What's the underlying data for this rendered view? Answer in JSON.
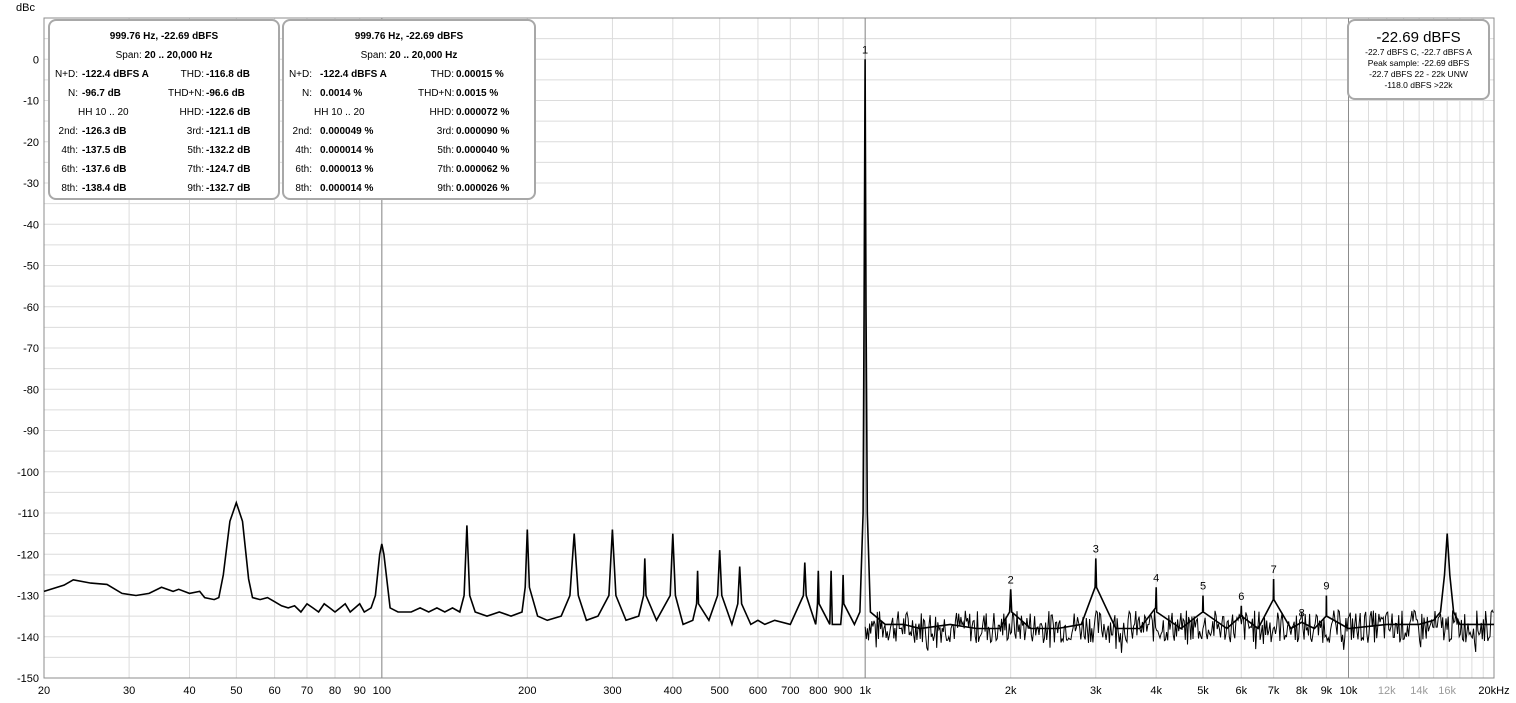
{
  "chart_data": {
    "type": "line",
    "ylabel": "dBc",
    "x_scale": "log",
    "xlim": [
      20,
      20000
    ],
    "ylim": [
      -150,
      10
    ],
    "x_ticks": [
      {
        "v": 20,
        "t": "20"
      },
      {
        "v": 30,
        "t": "30"
      },
      {
        "v": 40,
        "t": "40"
      },
      {
        "v": 50,
        "t": "50"
      },
      {
        "v": 60,
        "t": "60"
      },
      {
        "v": 70,
        "t": "70"
      },
      {
        "v": 80,
        "t": "80"
      },
      {
        "v": 90,
        "t": "90"
      },
      {
        "v": 100,
        "t": "100"
      },
      {
        "v": 200,
        "t": "200"
      },
      {
        "v": 300,
        "t": "300"
      },
      {
        "v": 400,
        "t": "400"
      },
      {
        "v": 500,
        "t": "500"
      },
      {
        "v": 600,
        "t": "600"
      },
      {
        "v": 700,
        "t": "700"
      },
      {
        "v": 800,
        "t": "800"
      },
      {
        "v": 900,
        "t": "900"
      },
      {
        "v": 1000,
        "t": "1k"
      },
      {
        "v": 2000,
        "t": "2k"
      },
      {
        "v": 3000,
        "t": "3k"
      },
      {
        "v": 4000,
        "t": "4k"
      },
      {
        "v": 5000,
        "t": "5k"
      },
      {
        "v": 6000,
        "t": "6k"
      },
      {
        "v": 7000,
        "t": "7k"
      },
      {
        "v": 8000,
        "t": "8k"
      },
      {
        "v": 9000,
        "t": "9k"
      },
      {
        "v": 10000,
        "t": "10k"
      },
      {
        "v": 12000,
        "t": "12k"
      },
      {
        "v": 14000,
        "t": "14k"
      },
      {
        "v": 16000,
        "t": "16k"
      },
      {
        "v": 20000,
        "t": "20kHz"
      }
    ],
    "y_ticks": [
      0,
      -10,
      -20,
      -30,
      -40,
      -50,
      -60,
      -70,
      -80,
      -90,
      -100,
      -110,
      -120,
      -130,
      -140,
      -150
    ],
    "grid": true,
    "series": [
      {
        "points": [
          [
            20,
            -129
          ],
          [
            22,
            -127.5
          ],
          [
            23,
            -126.2
          ],
          [
            25,
            -127
          ],
          [
            27,
            -127.3
          ],
          [
            29,
            -129.5
          ],
          [
            31,
            -130
          ],
          [
            33,
            -129.5
          ],
          [
            35,
            -128
          ],
          [
            37,
            -129
          ],
          [
            38,
            -128.5
          ],
          [
            40,
            -129.5
          ],
          [
            42,
            -129
          ],
          [
            43,
            -130.5
          ],
          [
            45,
            -131
          ],
          [
            46,
            -130.5
          ],
          [
            47,
            -125
          ],
          [
            48.5,
            -112
          ],
          [
            50,
            -107.5
          ],
          [
            51.5,
            -112
          ],
          [
            53,
            -126
          ],
          [
            54,
            -130.5
          ],
          [
            56,
            -131
          ],
          [
            58,
            -130.5
          ],
          [
            60,
            -131.5
          ],
          [
            62,
            -132.5
          ],
          [
            64,
            -133
          ],
          [
            66,
            -132.5
          ],
          [
            68,
            -134
          ],
          [
            70,
            -132
          ],
          [
            72,
            -133
          ],
          [
            74,
            -134
          ],
          [
            76,
            -132
          ],
          [
            78,
            -133
          ],
          [
            80,
            -134
          ],
          [
            82,
            -133
          ],
          [
            84,
            -132
          ],
          [
            86,
            -134
          ],
          [
            88,
            -133
          ],
          [
            90,
            -132
          ],
          [
            92,
            -134
          ],
          [
            95,
            -133
          ],
          [
            97,
            -130
          ],
          [
            99,
            -120
          ],
          [
            100,
            -117.5
          ],
          [
            101,
            -120
          ],
          [
            104,
            -133
          ],
          [
            108,
            -134
          ],
          [
            115,
            -134
          ],
          [
            120,
            -133
          ],
          [
            125,
            -134
          ],
          [
            130,
            -133
          ],
          [
            135,
            -134
          ],
          [
            140,
            -133
          ],
          [
            145,
            -134
          ],
          [
            148,
            -130
          ],
          [
            150,
            -113
          ],
          [
            152,
            -130
          ],
          [
            156,
            -134
          ],
          [
            165,
            -135
          ],
          [
            175,
            -134
          ],
          [
            185,
            -135
          ],
          [
            195,
            -134
          ],
          [
            198,
            -128
          ],
          [
            200,
            -114
          ],
          [
            202,
            -128
          ],
          [
            210,
            -135
          ],
          [
            220,
            -136
          ],
          [
            235,
            -135
          ],
          [
            245,
            -130
          ],
          [
            250,
            -115
          ],
          [
            255,
            -130
          ],
          [
            265,
            -136
          ],
          [
            280,
            -135
          ],
          [
            295,
            -130
          ],
          [
            300,
            -114
          ],
          [
            305,
            -130
          ],
          [
            320,
            -136
          ],
          [
            340,
            -135
          ],
          [
            348,
            -130
          ],
          [
            350,
            -121
          ],
          [
            352,
            -130
          ],
          [
            370,
            -136
          ],
          [
            395,
            -130
          ],
          [
            400,
            -115
          ],
          [
            405,
            -130
          ],
          [
            420,
            -137
          ],
          [
            440,
            -136
          ],
          [
            448,
            -132
          ],
          [
            450,
            -124
          ],
          [
            452,
            -132
          ],
          [
            475,
            -136
          ],
          [
            495,
            -130
          ],
          [
            500,
            -119
          ],
          [
            505,
            -130
          ],
          [
            530,
            -137
          ],
          [
            545,
            -132
          ],
          [
            550,
            -123
          ],
          [
            555,
            -132
          ],
          [
            580,
            -137
          ],
          [
            600,
            -136
          ],
          [
            620,
            -137
          ],
          [
            650,
            -136
          ],
          [
            700,
            -137
          ],
          [
            745,
            -130
          ],
          [
            750,
            -122
          ],
          [
            755,
            -130
          ],
          [
            790,
            -137
          ],
          [
            797,
            -132
          ],
          [
            800,
            -124
          ],
          [
            803,
            -132
          ],
          [
            845,
            -137
          ],
          [
            850,
            -124
          ],
          [
            855,
            -137
          ],
          [
            890,
            -137
          ],
          [
            897,
            -132
          ],
          [
            900,
            -125
          ],
          [
            903,
            -132
          ],
          [
            950,
            -137
          ],
          [
            975,
            -134
          ],
          [
            990,
            -110
          ],
          [
            995,
            -60
          ],
          [
            999.76,
            0
          ],
          [
            1004,
            -60
          ],
          [
            1010,
            -110
          ],
          [
            1025,
            -134
          ],
          [
            1100,
            -137
          ],
          [
            1200,
            -137
          ],
          [
            1300,
            -138
          ],
          [
            1500,
            -137
          ],
          [
            1700,
            -138
          ],
          [
            1900,
            -138
          ],
          [
            1990,
            -134
          ],
          [
            2000,
            -128.5
          ],
          [
            2010,
            -134
          ],
          [
            2200,
            -138
          ],
          [
            2500,
            -138
          ],
          [
            2800,
            -137
          ],
          [
            2990,
            -128
          ],
          [
            3000,
            -121
          ],
          [
            3010,
            -128
          ],
          [
            3300,
            -138
          ],
          [
            3700,
            -138
          ],
          [
            3990,
            -133
          ],
          [
            4000,
            -128
          ],
          [
            4010,
            -134
          ],
          [
            4500,
            -138
          ],
          [
            4990,
            -134
          ],
          [
            5000,
            -130
          ],
          [
            5010,
            -134
          ],
          [
            5600,
            -138
          ],
          [
            5990,
            -135
          ],
          [
            6000,
            -132.5
          ],
          [
            6010,
            -135
          ],
          [
            6500,
            -138
          ],
          [
            6990,
            -131
          ],
          [
            7000,
            -126
          ],
          [
            7010,
            -131
          ],
          [
            7600,
            -138
          ],
          [
            8000,
            -136.5
          ],
          [
            8500,
            -138
          ],
          [
            8990,
            -135
          ],
          [
            9000,
            -130
          ],
          [
            9010,
            -135
          ],
          [
            10000,
            -138
          ],
          [
            12000,
            -137
          ],
          [
            14000,
            -137
          ],
          [
            15000,
            -136
          ],
          [
            15500,
            -134
          ],
          [
            15800,
            -125
          ],
          [
            16000,
            -115
          ],
          [
            16200,
            -125
          ],
          [
            16500,
            -134
          ],
          [
            17000,
            -137
          ],
          [
            18000,
            -137
          ],
          [
            20000,
            -137
          ]
        ]
      }
    ],
    "noise_floor": {
      "from": 1000,
      "to": 20000,
      "level": -137.5,
      "spread": 4
    },
    "harmonic_labels": [
      {
        "text": "1",
        "x": 999.76,
        "y": 0
      },
      {
        "text": "2",
        "x": 2000,
        "y": -128.5
      },
      {
        "text": "3",
        "x": 3000,
        "y": -121
      },
      {
        "text": "4",
        "x": 4000,
        "y": -128
      },
      {
        "text": "5",
        "x": 5000,
        "y": -130
      },
      {
        "text": "6",
        "x": 6000,
        "y": -132.5
      },
      {
        "text": "7",
        "x": 7000,
        "y": -126
      },
      {
        "text": "8",
        "x": 8000,
        "y": -136.5
      },
      {
        "text": "9",
        "x": 9000,
        "y": -130
      }
    ]
  },
  "panel_db": {
    "header": "999.76 Hz, -22.69 dBFS",
    "span_label": "Span:",
    "span_value": "20 .. 20,000 Hz",
    "rows": [
      {
        "l1": "N+D:",
        "v1": "-122.4 dBFS A",
        "l2": "THD:",
        "v2": "-116.8 dB"
      },
      {
        "l1": "N:",
        "v1": "-96.7 dB",
        "l2": "THD+N:",
        "v2": "-96.6 dB"
      },
      {
        "l1": "",
        "v1": "",
        "l2": "HHD:",
        "v2": "-122.6 dB"
      },
      {
        "l1": "2nd:",
        "v1": "-126.3 dB",
        "l2": "3rd:",
        "v2": "-121.1 dB"
      },
      {
        "l1": "4th:",
        "v1": "-137.5 dB",
        "l2": "5th:",
        "v2": "-132.2 dB"
      },
      {
        "l1": "6th:",
        "v1": "-137.6 dB",
        "l2": "7th:",
        "v2": "-124.7 dB"
      },
      {
        "l1": "8th:",
        "v1": "-138.4 dB",
        "l2": "9th:",
        "v2": "-132.7 dB"
      }
    ],
    "hh_label": "HH 10 .. 20"
  },
  "panel_pct": {
    "header": "999.76 Hz, -22.69 dBFS",
    "span_label": "Span:",
    "span_value": "20 .. 20,000 Hz",
    "rows": [
      {
        "l1": "N+D:",
        "v1": "-122.4 dBFS A",
        "l2": "THD:",
        "v2": "0.00015 %"
      },
      {
        "l1": "N:",
        "v1": "0.0014 %",
        "l2": "THD+N:",
        "v2": "0.0015 %"
      },
      {
        "l1": "",
        "v1": "",
        "l2": "HHD:",
        "v2": "0.000072 %"
      },
      {
        "l1": "2nd:",
        "v1": "0.000049 %",
        "l2": "3rd:",
        "v2": "0.000090 %"
      },
      {
        "l1": "4th:",
        "v1": "0.000014 %",
        "l2": "5th:",
        "v2": "0.000040 %"
      },
      {
        "l1": "6th:",
        "v1": "0.000013 %",
        "l2": "7th:",
        "v2": "0.000062 %"
      },
      {
        "l1": "8th:",
        "v1": "0.000014 %",
        "l2": "9th:",
        "v2": "0.000026 %"
      }
    ],
    "hh_label": "HH 10 .. 20"
  },
  "level_box": {
    "big": "-22.69 dBFS",
    "lines": [
      "-22.7 dBFS C, -22.7 dBFS A",
      "Peak sample: -22.69 dBFS",
      "-22.7 dBFS 22 - 22k UNW",
      "-118.0 dBFS >22k"
    ]
  },
  "colors": {
    "trace": "#000000",
    "grid": "#d8d8d8",
    "axis_frame": "#8c8c8c",
    "panel_border": "#a8a8a8"
  }
}
